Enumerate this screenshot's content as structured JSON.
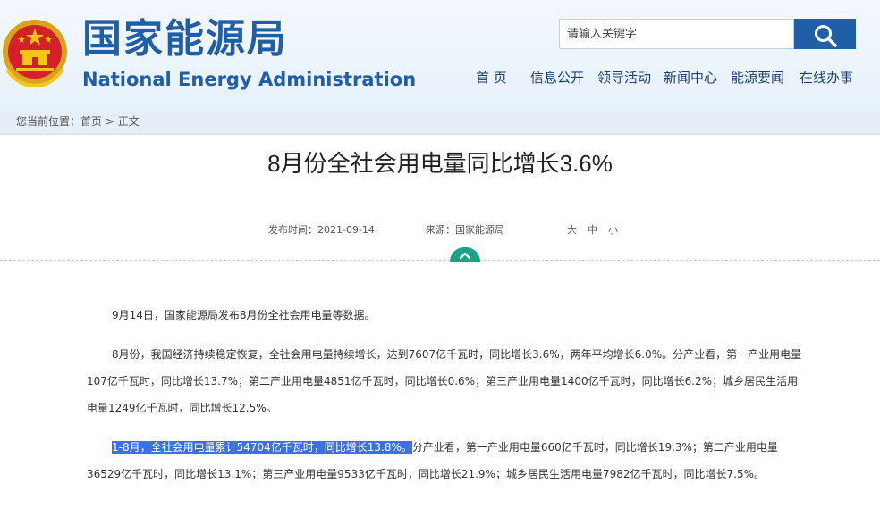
{
  "header": {
    "site_name_cn": "国家能源局",
    "site_name_en": "National Energy Administration",
    "search_placeholder": "请输入关键字"
  },
  "nav": [
    "首 页",
    "信息公开",
    "领导活动",
    "新闻中心",
    "能源要闻",
    "在线办事"
  ],
  "breadcrumb": {
    "label": "您当前位置：",
    "home": "首页",
    "separator": " > ",
    "current": "正文"
  },
  "article": {
    "title": "8月份全社会用电量同比增长3.6%",
    "publish_time": "发布时间：2021-09-14",
    "source": "来源：国家能源局",
    "font_size": [
      "大",
      "中",
      "小"
    ],
    "paragraphs": [
      {
        "text": "9月14日，国家能源局发布8月份全社会用电量等数据。"
      },
      {
        "text": "8月份，我国经济持续稳定恢复，全社会用电量持续增长，达到7607亿千瓦时，同比增长3.6%，两年平均增长6.0%。分产业看，第一产业用电量107亿千瓦时，同比增长13.7%；第二产业用电量4851亿千瓦时，同比增长0.6%；第三产业用电量1400亿千瓦时，同比增长6.2%；城乡居民生活用电量1249亿千瓦时，同比增长12.5%。"
      },
      {
        "highlight": "1-8月，全社会用电量累计54704亿千瓦时，同比增长13.8%。",
        "text": "分产业看，第一产业用电量660亿千瓦时，同比增长19.3%；第二产业用电量36529亿千瓦时，同比增长13.1%；第三产业用电量9533亿千瓦时，同比增长21.9%；城乡居民生活用电量7982亿千瓦时，同比增长7.5%。"
      }
    ]
  },
  "colors": {
    "brand_blue": "#1f5ea8",
    "header_bg": "#eaf3fc",
    "toggle_green": "#1aa389",
    "selection_blue": "#3a72e6"
  }
}
